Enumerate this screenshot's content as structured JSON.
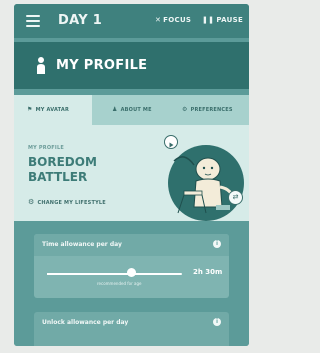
{
  "topbar": {
    "day_title": "DAY 1",
    "focus_label": "FOCUS",
    "pause_label": "PAUSE"
  },
  "profile": {
    "title": "MY PROFILE"
  },
  "tabs": [
    {
      "label": "MY AVATAR",
      "icon": "flag-icon"
    },
    {
      "label": "ABOUT ME",
      "icon": "person-icon"
    },
    {
      "label": "PREFERENCES",
      "icon": "gear-icon"
    }
  ],
  "avatar": {
    "profile_label": "MY PROFILE",
    "name": "BOREDOM BATTLER",
    "change_label": "CHANGE MY LIFESTYLE"
  },
  "time_allowance": {
    "title": "Time allowance per day",
    "value": "2h 30m",
    "caption": "recommended for age",
    "level": 0.62
  },
  "unlock_allowance": {
    "title": "Unlock allowance per day"
  },
  "colors": {
    "topbar": "#3f817e",
    "profile_bar": "#2f706d",
    "background": "#5c9b99",
    "tab_strip": "#a7d1cd",
    "panel": "#d6ebe8",
    "accent_text": "#3d7c78"
  }
}
